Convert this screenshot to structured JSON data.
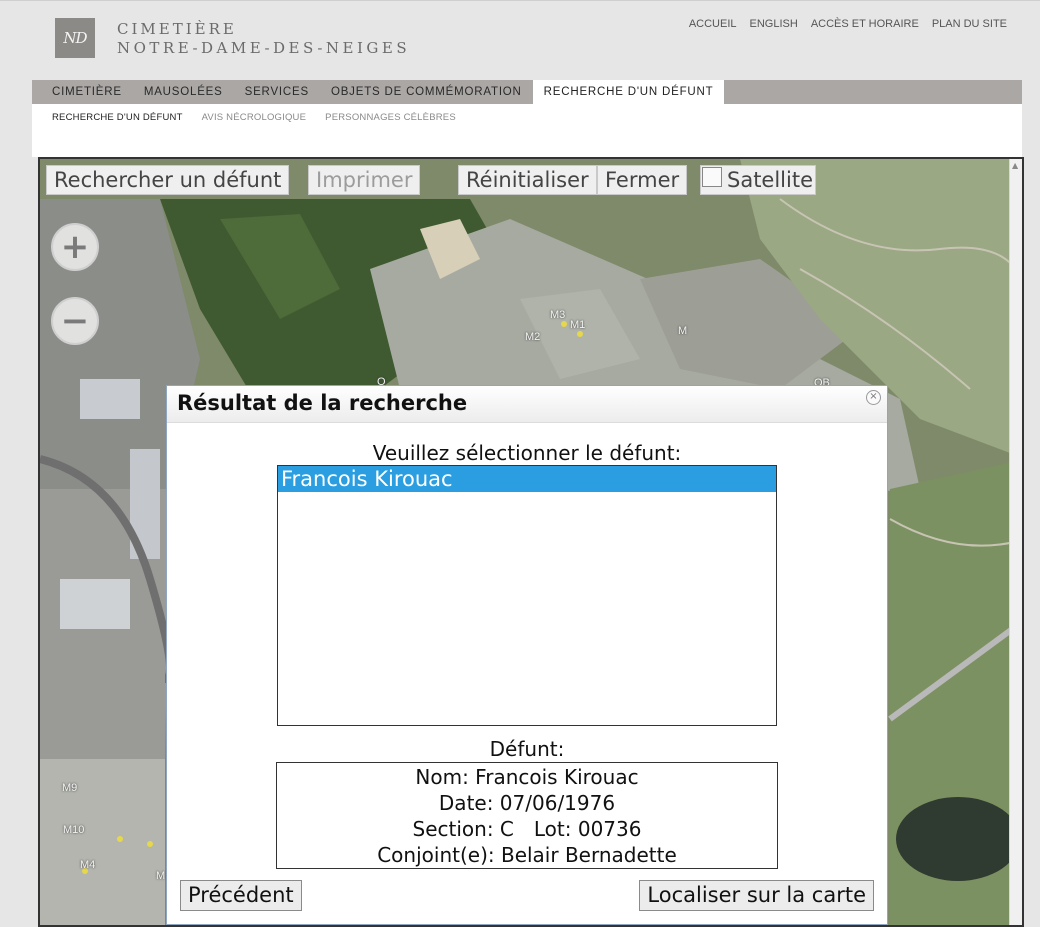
{
  "header": {
    "logo_text": "ND",
    "brand_line1": "Cimetière",
    "brand_line2": "Notre-Dame-des-Neiges",
    "top_links": [
      "ACCUEIL",
      "ENGLISH",
      "ACCÈS ET HORAIRE",
      "PLAN DU SITE"
    ]
  },
  "main_nav": [
    "CIMETIÈRE",
    "MAUSOLÉES",
    "SERVICES",
    "OBJETS DE COMMÉMORATION",
    "RECHERCHE D'UN DÉFUNT"
  ],
  "main_nav_active": "RECHERCHE D'UN DÉFUNT",
  "sub_nav": [
    "RECHERCHE D'UN DÉFUNT",
    "AVIS NÉCROLOGIQUE",
    "PERSONNAGES CÉLÈBRES"
  ],
  "sub_nav_active": "RECHERCHE D'UN DÉFUNT",
  "map_toolbar": {
    "search_label": "Rechercher un défunt",
    "print_label": "Imprimer",
    "reset_label": "Réinitialiser",
    "close_label": "Fermer",
    "satellite_label": "Satellite",
    "satellite_checked": false
  },
  "map_zoom": {
    "in": "+",
    "out": "−"
  },
  "map_labels": [
    "M3",
    "M1",
    "M2",
    "M",
    "O",
    "OB",
    "M9",
    "M10",
    "M4",
    "M"
  ],
  "dialog": {
    "title": "Résultat de la recherche",
    "prompt": "Veuillez sélectionner le défunt:",
    "results": [
      "Francois Kirouac"
    ],
    "selected_result": "Francois Kirouac",
    "deceased_label": "Défunt:",
    "details": {
      "name": "Nom: Francois Kirouac",
      "date": "Date: 07/06/1976",
      "section": "Section: C",
      "lot": "Lot: 00736",
      "spouse": "Conjoint(e): Belair Bernadette"
    },
    "prev_button": "Précédent",
    "locate_button": "Localiser sur la carte"
  },
  "colors": {
    "page_bg": "#e6e6e6",
    "nav_bg": "#aaa7a5",
    "selection": "#2a9ee0",
    "dialog_border": "#8ea6bf"
  }
}
